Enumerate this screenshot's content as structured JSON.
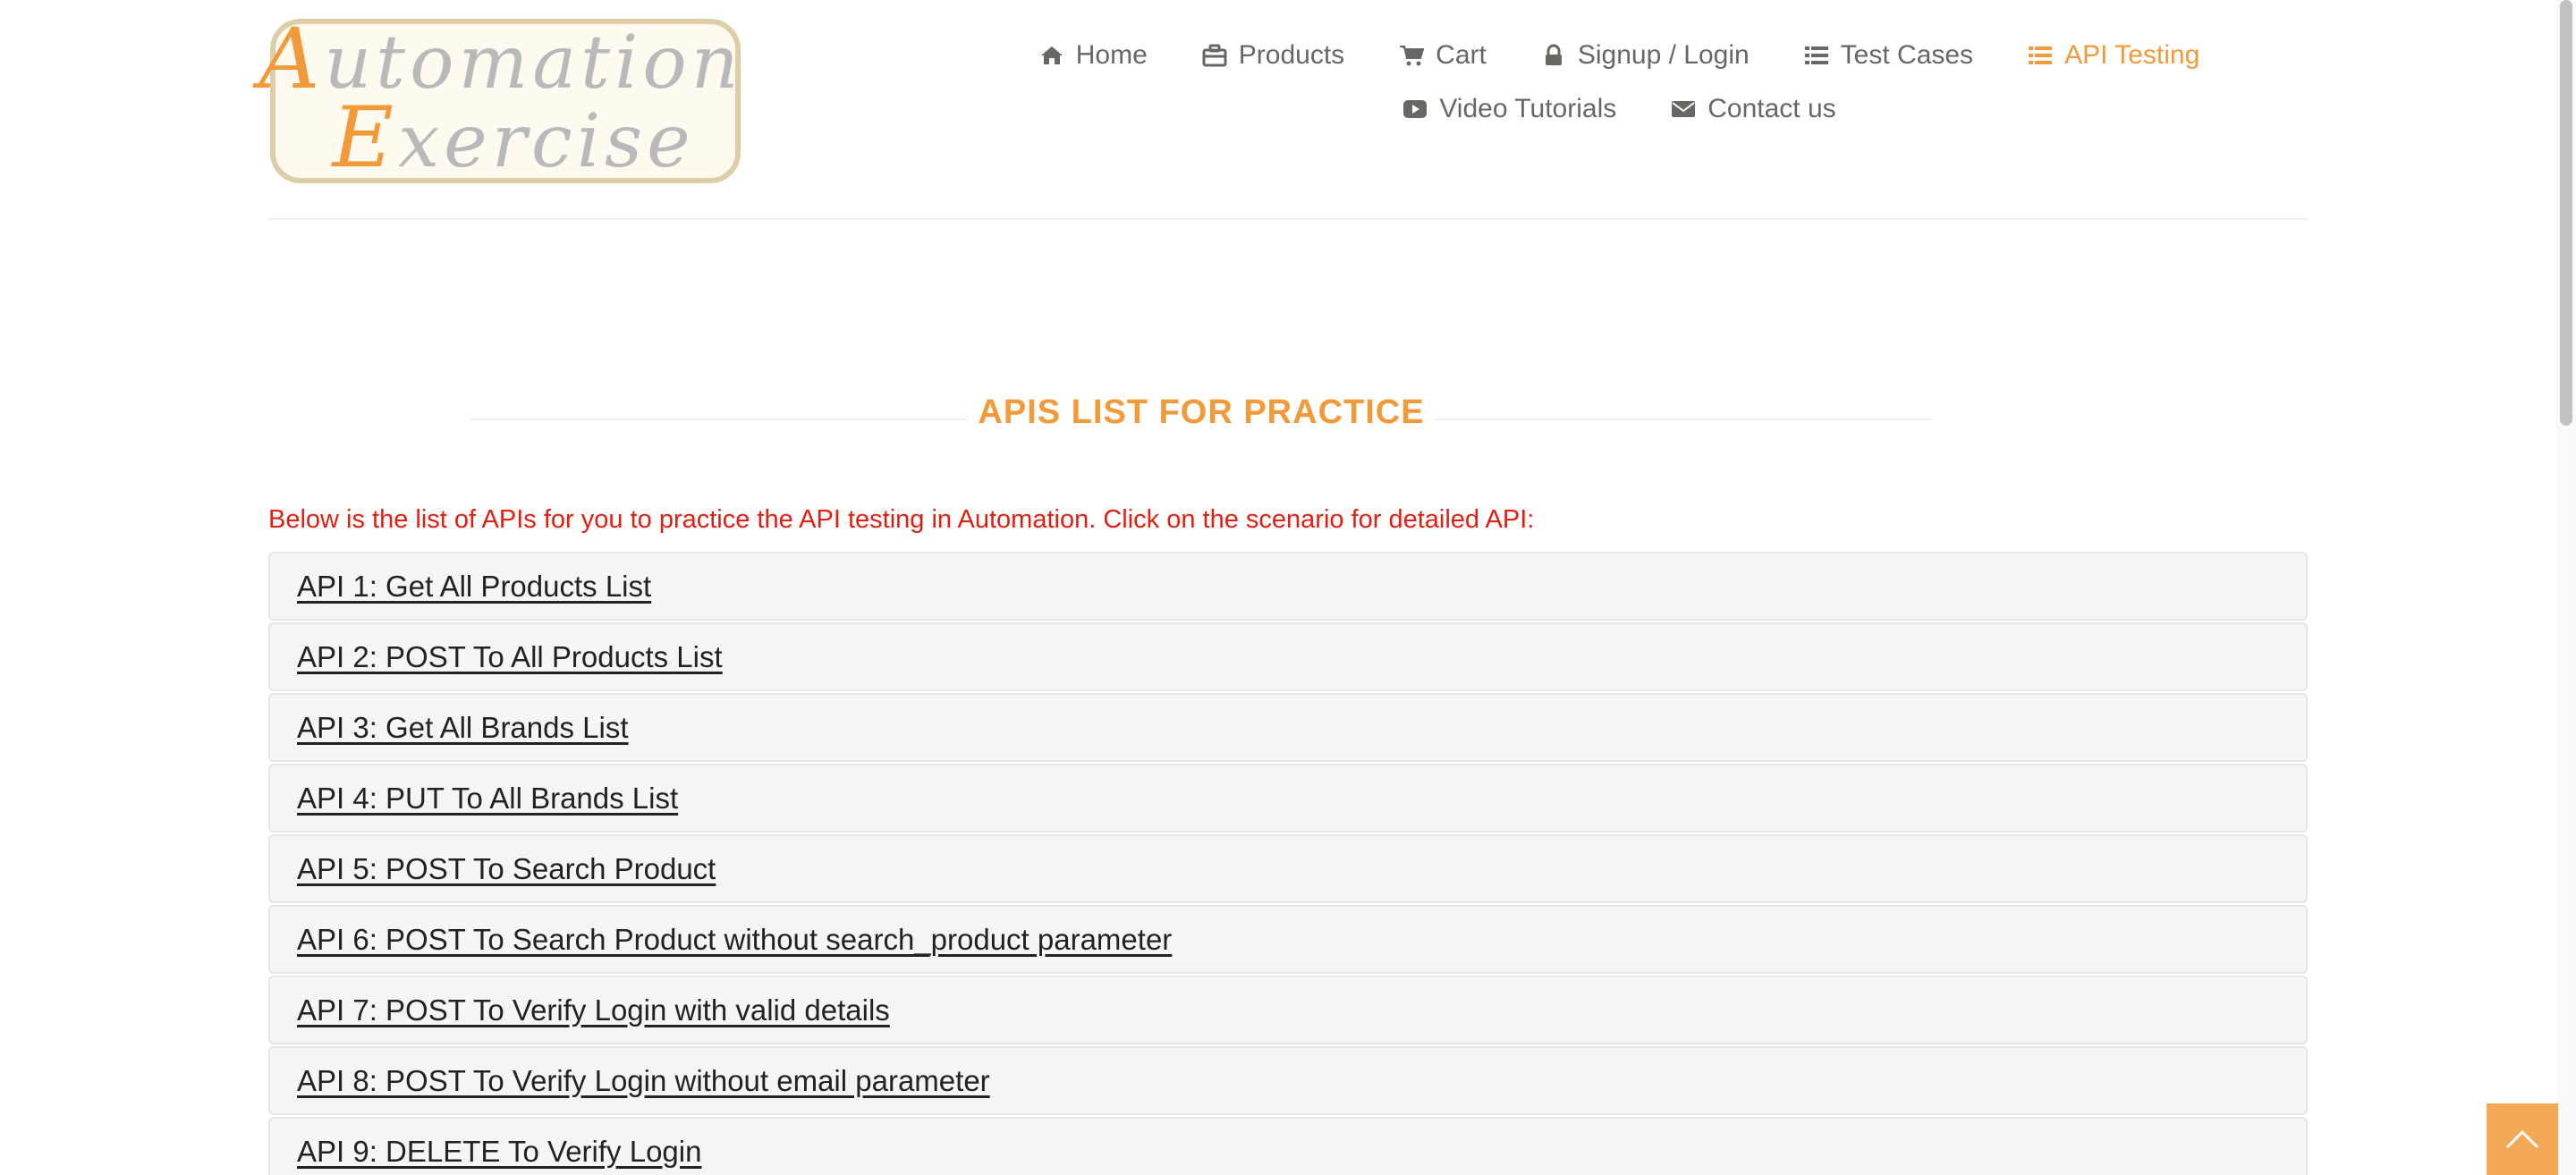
{
  "logo": {
    "line1_cap": "A",
    "line1_rest": "utomation",
    "line2_cap": "E",
    "line2_rest": "xercise"
  },
  "nav": {
    "items": [
      {
        "label": "Home",
        "icon": "home-icon"
      },
      {
        "label": "Products",
        "icon": "briefcase-icon"
      },
      {
        "label": "Cart",
        "icon": "cart-icon"
      },
      {
        "label": "Signup / Login",
        "icon": "lock-icon"
      },
      {
        "label": "Test Cases",
        "icon": "list-icon"
      },
      {
        "label": "API Testing",
        "icon": "list-icon",
        "active": true
      },
      {
        "label": "Video Tutorials",
        "icon": "youtube-play-icon"
      },
      {
        "label": "Contact us",
        "icon": "envelope-icon"
      }
    ]
  },
  "main": {
    "title": "APIS LIST FOR PRACTICE",
    "intro": "Below is the list of APIs for you to practice the API testing in Automation. Click on the scenario for detailed API:",
    "apis": [
      "API 1: Get All Products List",
      "API 2: POST To All Products List",
      "API 3: Get All Brands List",
      "API 4: PUT To All Brands List",
      "API 5: POST To Search Product",
      "API 6: POST To Search Product without search_product parameter",
      "API 7: POST To Verify Login with valid details",
      "API 8: POST To Verify Login without email parameter",
      "API 9: DELETE To Verify Login"
    ]
  },
  "colors": {
    "accent": "#F29A3A",
    "intro_text": "#E21F12",
    "nav_text": "#696763"
  }
}
